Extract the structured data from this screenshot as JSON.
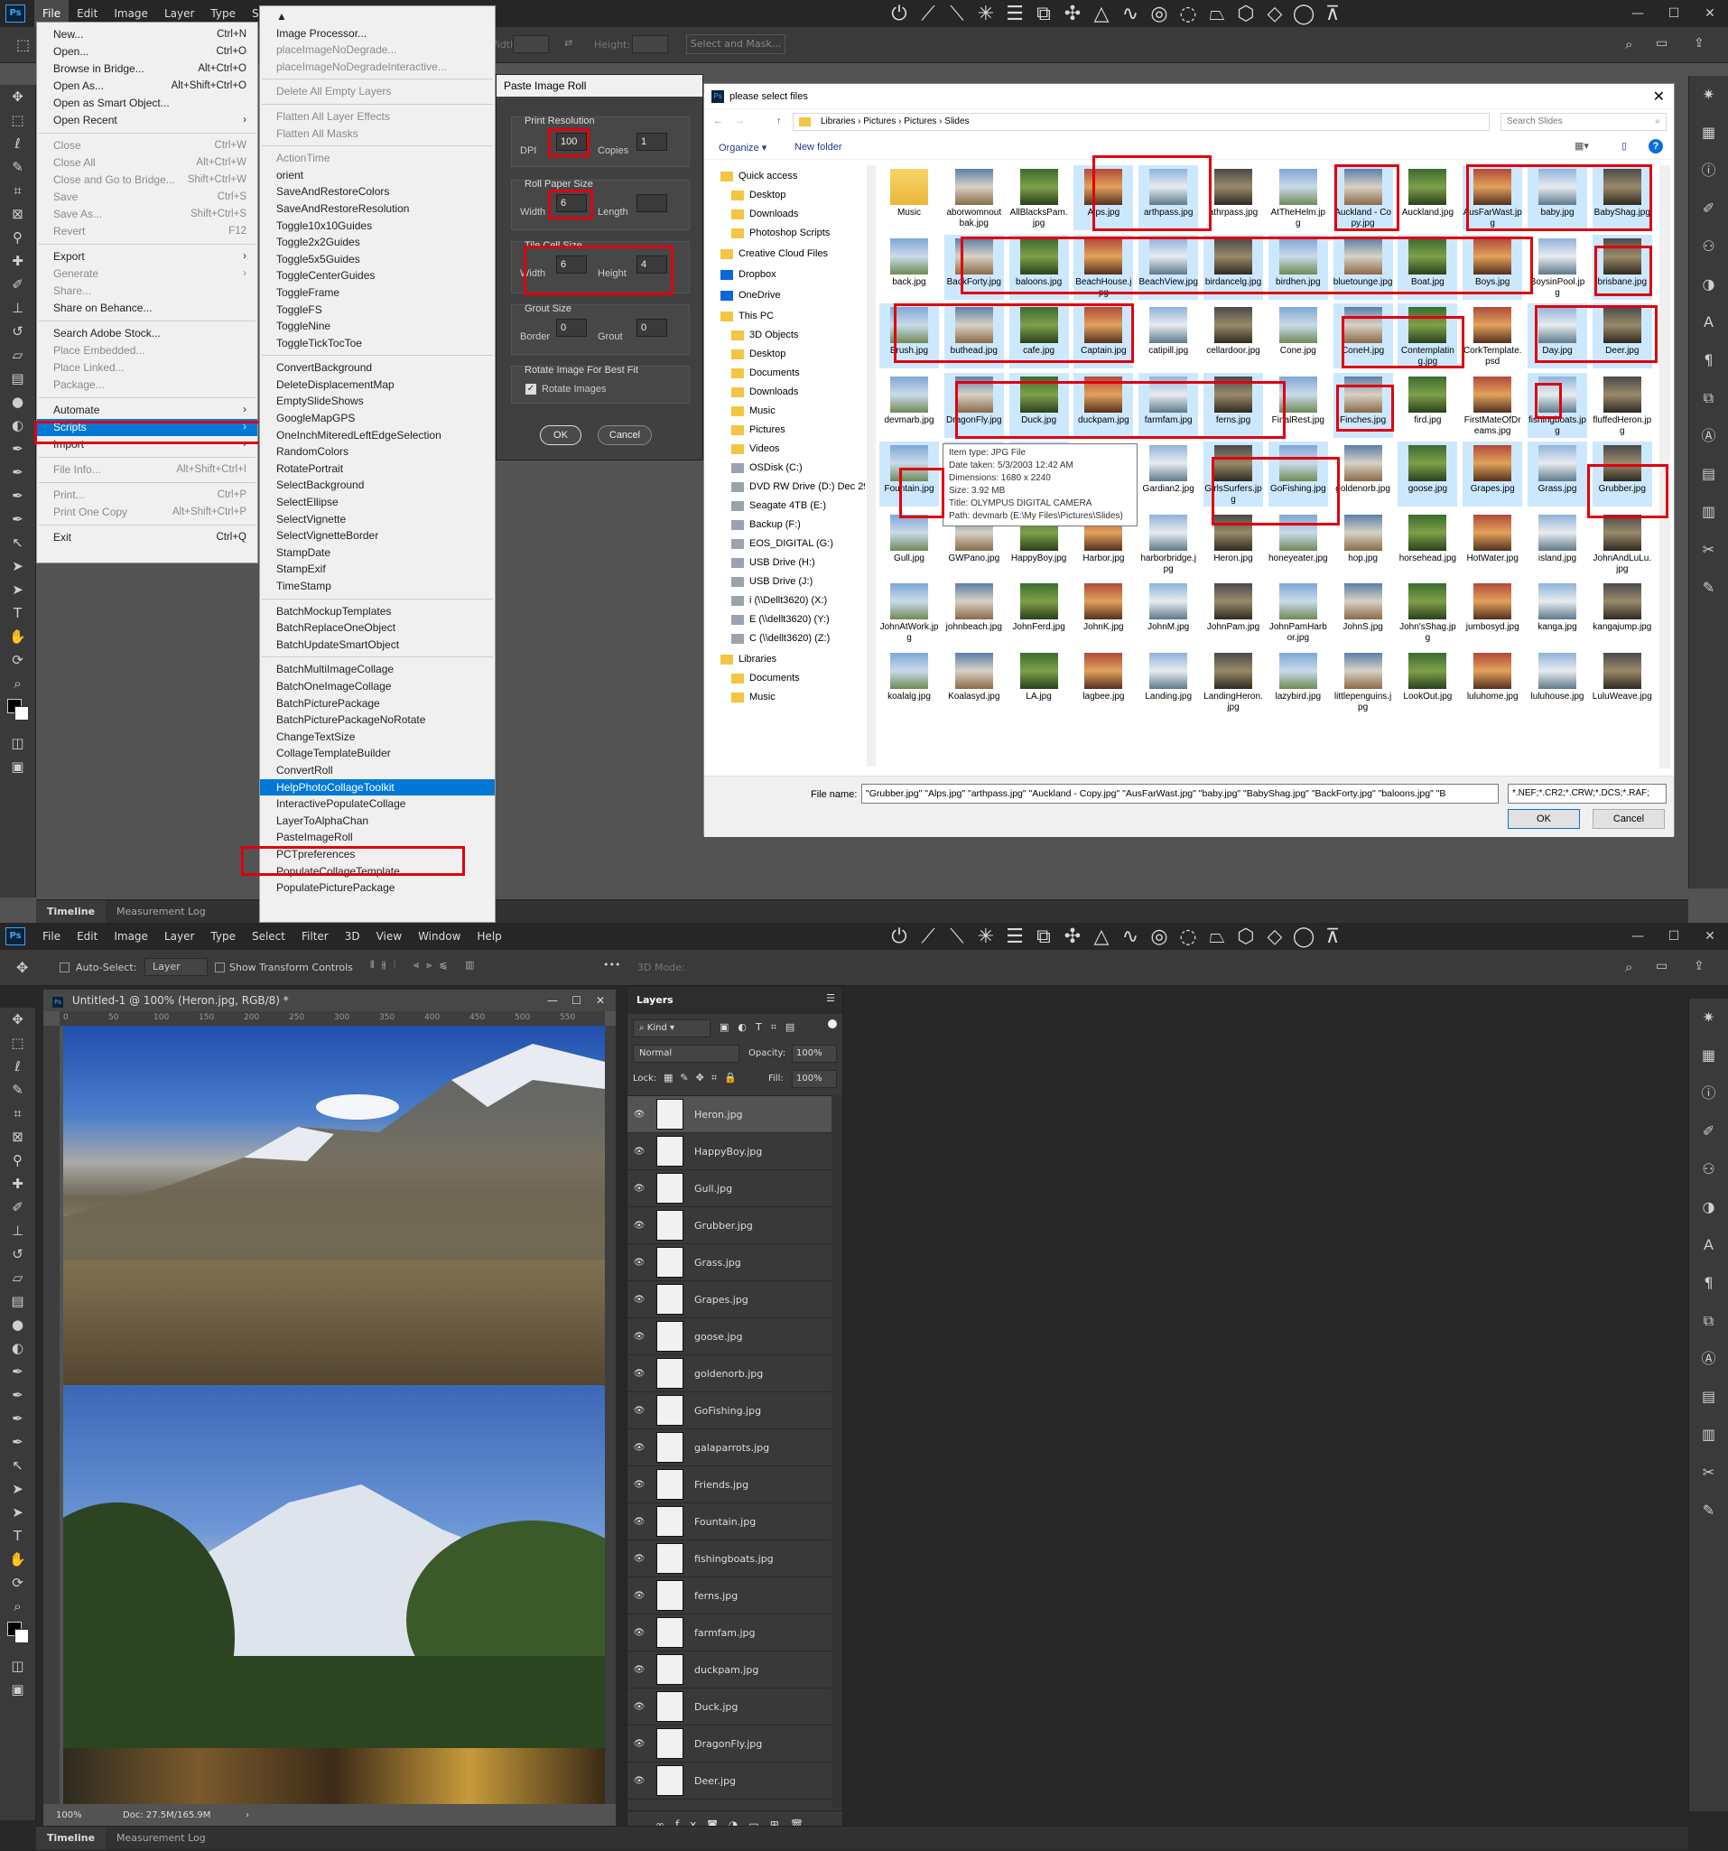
{
  "top": {
    "menubar": [
      "File",
      "Edit",
      "Image",
      "Layer",
      "Type",
      "Select"
    ],
    "options": {
      "width_label": "Width:",
      "height_label": "Height:",
      "select_mask": "Select and Mask..."
    },
    "bottom_tabs": [
      "Timeline",
      "Measurement Log"
    ]
  },
  "file_menu": [
    {
      "l": "New...",
      "s": "Ctrl+N"
    },
    {
      "l": "Open...",
      "s": "Ctrl+O"
    },
    {
      "l": "Browse in Bridge...",
      "s": "Alt+Ctrl+O"
    },
    {
      "l": "Open As...",
      "s": "Alt+Shift+Ctrl+O"
    },
    {
      "l": "Open as Smart Object...",
      "s": ""
    },
    {
      "l": "Open Recent",
      "s": "›"
    },
    {
      "sep": true
    },
    {
      "l": "Close",
      "s": "Ctrl+W",
      "d": true
    },
    {
      "l": "Close All",
      "s": "Alt+Ctrl+W",
      "d": true
    },
    {
      "l": "Close and Go to Bridge...",
      "s": "Shift+Ctrl+W",
      "d": true
    },
    {
      "l": "Save",
      "s": "Ctrl+S",
      "d": true
    },
    {
      "l": "Save As...",
      "s": "Shift+Ctrl+S",
      "d": true
    },
    {
      "l": "Revert",
      "s": "F12",
      "d": true
    },
    {
      "sep": true
    },
    {
      "l": "Export",
      "s": "›"
    },
    {
      "l": "Generate",
      "s": "›",
      "d": true
    },
    {
      "l": "Share...",
      "s": "",
      "d": true
    },
    {
      "l": "Share on Behance...",
      "s": ""
    },
    {
      "sep": true
    },
    {
      "l": "Search Adobe Stock...",
      "s": ""
    },
    {
      "l": "Place Embedded...",
      "s": "",
      "d": true
    },
    {
      "l": "Place Linked...",
      "s": "",
      "d": true
    },
    {
      "l": "Package...",
      "s": "",
      "d": true
    },
    {
      "sep": true
    },
    {
      "l": "Automate",
      "s": "›"
    },
    {
      "l": "Scripts",
      "s": "›",
      "h": true
    },
    {
      "l": "Import",
      "s": "›"
    },
    {
      "sep": true
    },
    {
      "l": "File Info...",
      "s": "Alt+Shift+Ctrl+I",
      "d": true
    },
    {
      "sep": true
    },
    {
      "l": "Print...",
      "s": "Ctrl+P",
      "d": true
    },
    {
      "l": "Print One Copy",
      "s": "Alt+Shift+Ctrl+P",
      "d": true
    },
    {
      "sep": true
    },
    {
      "l": "Exit",
      "s": "Ctrl+Q"
    }
  ],
  "scripts_menu": [
    {
      "l": "▲"
    },
    {
      "l": "Image Processor..."
    },
    {
      "l": "placeImageNoDegrade...",
      "d": true
    },
    {
      "l": "placeImageNoDegradeInteractive...",
      "d": true
    },
    {
      "sep": true
    },
    {
      "l": "Delete All Empty Layers",
      "d": true
    },
    {
      "sep": true
    },
    {
      "l": "Flatten All Layer Effects",
      "d": true
    },
    {
      "l": "Flatten All Masks",
      "d": true
    },
    {
      "sep": true
    },
    {
      "l": "ActionTime",
      "d": true
    },
    {
      "l": "orient"
    },
    {
      "l": "SaveAndRestoreColors"
    },
    {
      "l": "SaveAndRestoreResolution"
    },
    {
      "l": "Toggle10x10Guides"
    },
    {
      "l": "Toggle2x2Guides"
    },
    {
      "l": "Toggle5x5Guides"
    },
    {
      "l": "ToggleCenterGuides"
    },
    {
      "l": "ToggleFrame"
    },
    {
      "l": "ToggleFS"
    },
    {
      "l": "ToggleNine"
    },
    {
      "l": "ToggleTickTocToe"
    },
    {
      "sep": true
    },
    {
      "l": "ConvertBackground"
    },
    {
      "l": "DeleteDisplacementMap"
    },
    {
      "l": "EmptySlideShows"
    },
    {
      "l": "GoogleMapGPS"
    },
    {
      "l": "OneInchMiteredLeftEdgeSelection"
    },
    {
      "l": "RandomColors"
    },
    {
      "l": "RotatePortrait"
    },
    {
      "l": "SelectBackground"
    },
    {
      "l": "SelectEllipse"
    },
    {
      "l": "SelectVignette"
    },
    {
      "l": "SelectVignetteBorder"
    },
    {
      "l": "StampDate"
    },
    {
      "l": "StampExif"
    },
    {
      "l": "TimeStamp"
    },
    {
      "sep": true
    },
    {
      "l": "BatchMockupTemplates"
    },
    {
      "l": "BatchReplaceOneObject"
    },
    {
      "l": "BatchUpdateSmartObject"
    },
    {
      "sep": true
    },
    {
      "l": "BatchMultiImageCollage"
    },
    {
      "l": "BatchOneImageCollage"
    },
    {
      "l": "BatchPicturePackage"
    },
    {
      "l": "BatchPicturePackageNoRotate"
    },
    {
      "l": "ChangeTextSize"
    },
    {
      "l": "CollageTemplateBuilder"
    },
    {
      "l": "ConvertRoll"
    },
    {
      "l": "HelpPhotoCollageToolkit",
      "h": true
    },
    {
      "l": "InteractivePopulateCollage"
    },
    {
      "l": "LayerToAlphaChan"
    },
    {
      "l": "PasteImageRoll"
    },
    {
      "l": "PCTpreferences"
    },
    {
      "l": "PopulateCollageTemplate"
    },
    {
      "l": "PopulatePicturePackage"
    }
  ],
  "paste_dialog": {
    "title": "Paste Image Roll",
    "print_resolution": "Print Resolution",
    "dpi_label": "DPI",
    "dpi": "100",
    "copies_label": "Copies",
    "copies": "1",
    "roll_paper": "Roll Paper Size",
    "roll_width_label": "Width",
    "roll_width": "6",
    "length_label": "Length",
    "length": "",
    "tile_cell": "Tile Cell Size",
    "tile_width_label": "Width",
    "tile_width": "6",
    "tile_height_label": "Height",
    "tile_height": "4",
    "grout_size": "Grout Size",
    "border_label": "Border",
    "border": "0",
    "grout_label": "Grout",
    "grout": "0",
    "rotate_group": "Rotate Image For Best Fit",
    "rotate_label": "Rotate Images",
    "ok": "OK",
    "cancel": "Cancel"
  },
  "file_dialog": {
    "title": "please select files",
    "path": [
      "Libraries",
      "Pictures",
      "Pictures",
      "Slides"
    ],
    "search_placeholder": "Search Slides",
    "organize": "Organize ▾",
    "new_folder": "New folder",
    "nav": [
      "Quick access",
      "Desktop",
      "Downloads",
      "Photoshop Scripts",
      "Creative Cloud Files",
      "Dropbox",
      "OneDrive",
      "This PC",
      "3D Objects",
      "Desktop",
      "Documents",
      "Downloads",
      "Music",
      "Pictures",
      "Videos",
      "OSDisk (C:)",
      "DVD RW Drive (D:) Dec 29 2",
      "Seagate 4TB (E:)",
      "Backup (F:)",
      "EOS_DIGITAL (G:)",
      "USB Drive (H:)",
      "USB Drive (J:)",
      "i (\\\\Dellt3620) (X:)",
      "E (\\\\dellt3620) (Y:)",
      "C (\\\\dellt3620) (Z:)",
      "Libraries",
      "Documents",
      "Music"
    ],
    "files": [
      {
        "n": "Music",
        "s": 0
      },
      {
        "n": "aborwomnoutbak.jpg",
        "s": 0
      },
      {
        "n": "AllBlacksPam.jpg",
        "s": 0
      },
      {
        "n": "Alps.jpg",
        "s": 1
      },
      {
        "n": "arthpass.jpg",
        "s": 1
      },
      {
        "n": "athrpass.jpg",
        "s": 0
      },
      {
        "n": "AtTheHelm.jpg",
        "s": 0
      },
      {
        "n": "Auckland - Copy.jpg",
        "s": 1
      },
      {
        "n": "Auckland.jpg",
        "s": 0
      },
      {
        "n": "AusFarWast.jpg",
        "s": 1
      },
      {
        "n": "baby.jpg",
        "s": 1
      },
      {
        "n": "BabyShag.jpg",
        "s": 1
      },
      {
        "n": "back.jpg",
        "s": 0
      },
      {
        "n": "BackForty.jpg",
        "s": 1
      },
      {
        "n": "baloons.jpg",
        "s": 1
      },
      {
        "n": "BeachHouse.jpg",
        "s": 1
      },
      {
        "n": "BeachView.jpg",
        "s": 1
      },
      {
        "n": "birdancelg.jpg",
        "s": 1
      },
      {
        "n": "birdhen.jpg",
        "s": 1
      },
      {
        "n": "bluetounge.jpg",
        "s": 1
      },
      {
        "n": "Boat.jpg",
        "s": 1
      },
      {
        "n": "Boys.jpg",
        "s": 1
      },
      {
        "n": "BoysinPool.jpg",
        "s": 0
      },
      {
        "n": "brisbane.jpg",
        "s": 1
      },
      {
        "n": "Brush.jpg",
        "s": 1
      },
      {
        "n": "buthead.jpg",
        "s": 1
      },
      {
        "n": "cafe.jpg",
        "s": 1
      },
      {
        "n": "Captain.jpg",
        "s": 1
      },
      {
        "n": "catipill.jpg",
        "s": 0
      },
      {
        "n": "cellardoor.jpg",
        "s": 0
      },
      {
        "n": "Cone.jpg",
        "s": 0
      },
      {
        "n": "ConeH.jpg",
        "s": 1
      },
      {
        "n": "Contemplating.jpg",
        "s": 1
      },
      {
        "n": "CorkTemplate.psd",
        "s": 0
      },
      {
        "n": "Day.jpg",
        "s": 1
      },
      {
        "n": "Deer.jpg",
        "s": 1
      },
      {
        "n": "devmarb.jpg",
        "s": 0
      },
      {
        "n": "DragonFly.jpg",
        "s": 1
      },
      {
        "n": "Duck.jpg",
        "s": 1
      },
      {
        "n": "duckpam.jpg",
        "s": 1
      },
      {
        "n": "farmfam.jpg",
        "s": 1
      },
      {
        "n": "ferns.jpg",
        "s": 1
      },
      {
        "n": "FinalRest.jpg",
        "s": 0
      },
      {
        "n": "Finches.jpg",
        "s": 1
      },
      {
        "n": "fird.jpg",
        "s": 0
      },
      {
        "n": "FirstMateOfDreams.jpg",
        "s": 0
      },
      {
        "n": "fishingboats.jpg",
        "s": 1
      },
      {
        "n": "fluffedHeron.jpg",
        "s": 0
      },
      {
        "n": "Fountain.jpg",
        "s": 1
      },
      {
        "n": "Friends.jpg",
        "s": 1
      },
      {
        "n": "galaparrots.jpg",
        "s": 1
      },
      {
        "n": "",
        "s": 0
      },
      {
        "n": "Gardian2.jpg",
        "s": 0
      },
      {
        "n": "GirlsSurfers.jpg",
        "s": 1
      },
      {
        "n": "GoFishing.jpg",
        "s": 1
      },
      {
        "n": "goldenorb.jpg",
        "s": 0
      },
      {
        "n": "goose.jpg",
        "s": 1
      },
      {
        "n": "Grapes.jpg",
        "s": 1
      },
      {
        "n": "Grass.jpg",
        "s": 1
      },
      {
        "n": "Grubber.jpg",
        "s": 1
      },
      {
        "n": "Gull.jpg",
        "s": 0
      },
      {
        "n": "GWPano.jpg",
        "s": 0
      },
      {
        "n": "HappyBoy.jpg",
        "s": 0
      },
      {
        "n": "Harbor.jpg",
        "s": 0
      },
      {
        "n": "harborbridge.jpg",
        "s": 0
      },
      {
        "n": "Heron.jpg",
        "s": 0
      },
      {
        "n": "honeyeater.jpg",
        "s": 0
      },
      {
        "n": "hop.jpg",
        "s": 0
      },
      {
        "n": "horsehead.jpg",
        "s": 0
      },
      {
        "n": "HotWater.jpg",
        "s": 0
      },
      {
        "n": "island.jpg",
        "s": 0
      },
      {
        "n": "JohnAndLuLu.jpg",
        "s": 0
      },
      {
        "n": "JohnAtWork.jpg",
        "s": 0
      },
      {
        "n": "johnbeach.jpg",
        "s": 0
      },
      {
        "n": "JohnFerd.jpg",
        "s": 0
      },
      {
        "n": "JohnK.jpg",
        "s": 0
      },
      {
        "n": "JohnM.jpg",
        "s": 0
      },
      {
        "n": "JohnPam.jpg",
        "s": 0
      },
      {
        "n": "JohnPamHarbor.jpg",
        "s": 0
      },
      {
        "n": "JohnS.jpg",
        "s": 0
      },
      {
        "n": "John'sShag.jpg",
        "s": 0
      },
      {
        "n": "jumbosyd.jpg",
        "s": 0
      },
      {
        "n": "kanga.jpg",
        "s": 0
      },
      {
        "n": "kangajump.jpg",
        "s": 0
      },
      {
        "n": "koalalg.jpg",
        "s": 0
      },
      {
        "n": "Koalasyd.jpg",
        "s": 0
      },
      {
        "n": "LA.jpg",
        "s": 0
      },
      {
        "n": "lagbee.jpg",
        "s": 0
      },
      {
        "n": "Landing.jpg",
        "s": 0
      },
      {
        "n": "LandingHeron.jpg",
        "s": 0
      },
      {
        "n": "lazybird.jpg",
        "s": 0
      },
      {
        "n": "littlepenguins.jpg",
        "s": 0
      },
      {
        "n": "LookOut.jpg",
        "s": 0
      },
      {
        "n": "luluhome.jpg",
        "s": 0
      },
      {
        "n": "luluhouse.jpg",
        "s": 0
      },
      {
        "n": "LuluWeave.jpg",
        "s": 0
      }
    ],
    "tooltip": [
      "Item type: JPG File",
      "Date taken: 5/3/2003 12:42 AM",
      "Dimensions: 1680 x 2240",
      "Size: 3.92 MB",
      "Title: OLYMPUS DIGITAL CAMERA",
      "Path: devmarb (E:\\My Files\\Pictures\\Slides)"
    ],
    "filename_label": "File name:",
    "filename": "\"Grubber.jpg\" \"Alps.jpg\" \"arthpass.jpg\" \"Auckland - Copy.jpg\" \"AusFarWast.jpg\" \"baby.jpg\" \"BabyShag.jpg\" \"BackForty.jpg\" \"baloons.jpg\" \"B",
    "filetype": "*.NEF;*.CR2;*.CRW;*.DCS;*.RAF;",
    "ok": "OK",
    "cancel": "Cancel"
  },
  "bottom": {
    "menubar": [
      "File",
      "Edit",
      "Image",
      "Layer",
      "Type",
      "Select",
      "Filter",
      "3D",
      "View",
      "Window",
      "Help"
    ],
    "options": {
      "auto_select": "Auto-Select:",
      "layer": "Layer",
      "show_transform": "Show Transform Controls",
      "mode3d": "3D Mode:"
    },
    "doc_title": "Untitled-1 @ 100% (Heron.jpg, RGB/8) *",
    "ruler_ticks": [
      "0",
      "50",
      "100",
      "150",
      "200",
      "250",
      "300",
      "350",
      "400",
      "450",
      "500",
      "550"
    ],
    "zoom": "100%",
    "doc_size": "Doc: 27.5M/165.9M",
    "layers_title": "Layers",
    "kind": "Kind",
    "blend": "Normal",
    "opacity_label": "Opacity:",
    "opacity": "100%",
    "lock_label": "Lock:",
    "fill_label": "Fill:",
    "fill": "100%",
    "layers": [
      "Heron.jpg",
      "HappyBoy.jpg",
      "Gull.jpg",
      "Grubber.jpg",
      "Grass.jpg",
      "Grapes.jpg",
      "goose.jpg",
      "goldenorb.jpg",
      "GoFishing.jpg",
      "galaparrots.jpg",
      "Friends.jpg",
      "Fountain.jpg",
      "fishingboats.jpg",
      "ferns.jpg",
      "farmfam.jpg",
      "duckpam.jpg",
      "Duck.jpg",
      "DragonFly.jpg",
      "Deer.jpg"
    ],
    "bottom_tabs": [
      "Timeline",
      "Measurement Log"
    ]
  }
}
